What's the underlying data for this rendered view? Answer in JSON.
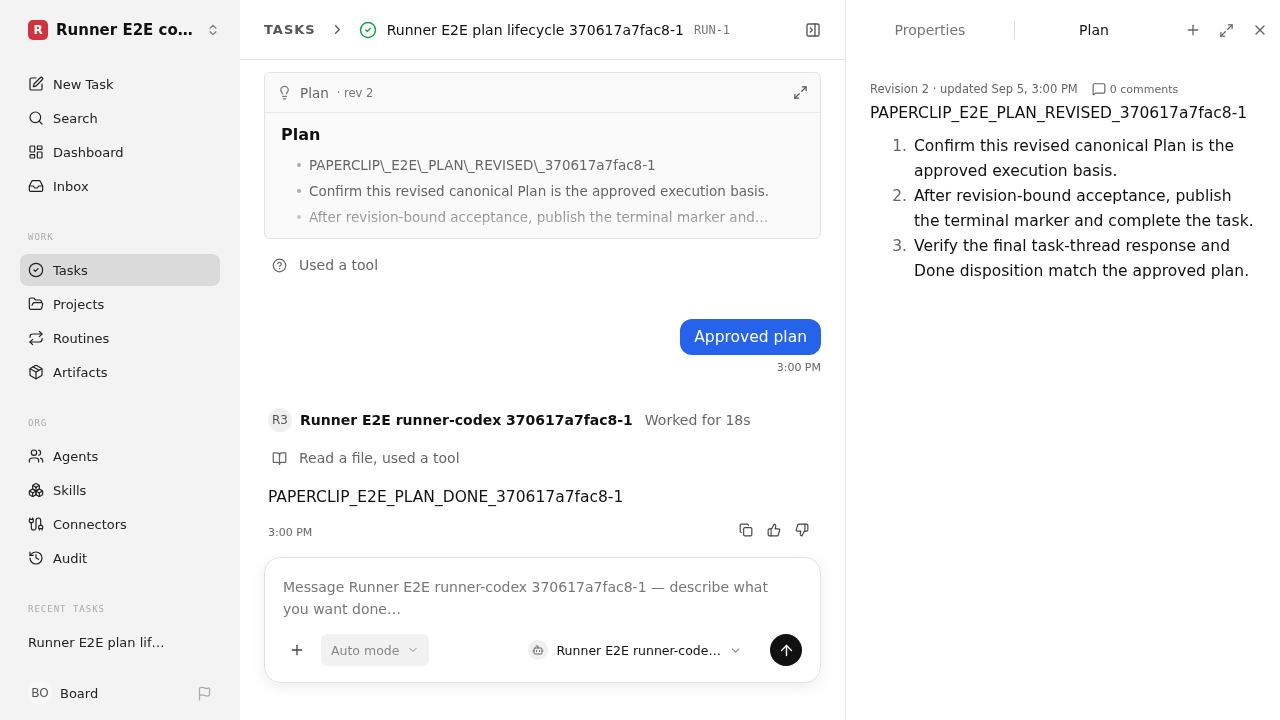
{
  "workspace": {
    "logo": "R",
    "name": "Runner E2E co…"
  },
  "nav_top": [
    {
      "label": "New Task",
      "selected": false
    },
    {
      "label": "Search",
      "selected": false
    },
    {
      "label": "Dashboard",
      "selected": false
    },
    {
      "label": "Inbox",
      "selected": false
    }
  ],
  "sections": [
    {
      "title": "WORK",
      "items": [
        {
          "label": "Tasks",
          "selected": true
        },
        {
          "label": "Projects",
          "selected": false
        },
        {
          "label": "Routines",
          "selected": false
        },
        {
          "label": "Artifacts",
          "selected": false
        }
      ]
    },
    {
      "title": "ORG",
      "items": [
        {
          "label": "Agents",
          "selected": false
        },
        {
          "label": "Skills",
          "selected": false
        },
        {
          "label": "Connectors",
          "selected": false
        },
        {
          "label": "Audit",
          "selected": false
        }
      ]
    }
  ],
  "recent_tasks": {
    "title": "RECENT TASKS",
    "items": [
      "Runner E2E plan lif…"
    ]
  },
  "user": {
    "initials": "BO",
    "name": "Board"
  },
  "header": {
    "crumb": "TASKS",
    "title": "Runner E2E plan lifecycle 370617a7fac8-1",
    "run_id": "RUN-1"
  },
  "plan_card": {
    "label": "Plan",
    "rev": "· rev 2",
    "heading": "Plan",
    "bullets": [
      "PAPERCLIP\\_E2E\\_PLAN\\_REVISED\\_370617a7fac8-1",
      "Confirm this revised canonical Plan is the approved execution basis.",
      "After revision-bound acceptance, publish the terminal marker and…"
    ]
  },
  "messages": [
    {
      "kind": "tool",
      "text": "Used a tool"
    },
    {
      "kind": "user",
      "text": "Approved plan",
      "time": "3:00 PM"
    },
    {
      "kind": "agent",
      "initials": "R3",
      "name": "Runner E2E runner-codex 370617a7fac8-1",
      "status": "Worked for 18s"
    },
    {
      "kind": "file",
      "text": "Read a file, used a tool"
    },
    {
      "kind": "reply",
      "text": "PAPERCLIP_E2E_PLAN_DONE_370617a7fac8-1",
      "time": "3:00 PM"
    }
  ],
  "composer": {
    "placeholder": "Message Runner E2E runner-codex 370617a7fac8-1 — describe what you want done…",
    "mode": "Auto mode",
    "agent": "Runner E2E runner-code…"
  },
  "panel": {
    "tabs": [
      {
        "label": "Properties",
        "selected": false
      },
      {
        "label": "Plan",
        "selected": true
      }
    ],
    "meta": "Revision 2 · updated Sep 5, 3:00 PM",
    "comments": "0 comments",
    "title": "PAPERCLIP_E2E_PLAN_REVISED_370617a7fac8-1",
    "steps": [
      {
        "number": "1.",
        "text": "Confirm this revised canonical Plan is the approved execution basis."
      },
      {
        "number": "2.",
        "text": "After revision-bound acceptance, publish the terminal marker and complete the task."
      },
      {
        "number": "3.",
        "text": "Verify the final task-thread response and Done disposition match the approved plan."
      }
    ]
  }
}
